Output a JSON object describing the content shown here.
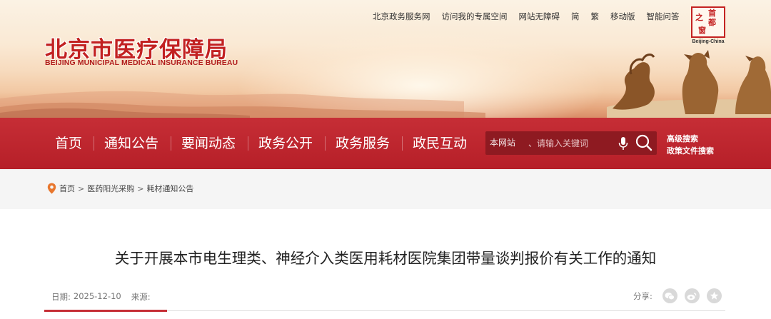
{
  "header": {
    "top_links": [
      "北京政务服务网",
      "访问我的专属空间",
      "网站无障碍",
      "简",
      "繁",
      "移动版",
      "智能问答"
    ],
    "logo_cn": "北京市医疗保障局",
    "logo_en": "BEIJING MUNICIPAL MEDICAL INSURANCE BUREAU",
    "seal": {
      "chars": [
        "首",
        "都",
        "之",
        "窗"
      ],
      "caption": "Beijing-China"
    }
  },
  "nav": {
    "items": [
      "首页",
      "通知公告",
      "要闻动态",
      "政务公开",
      "政务服务",
      "政民互动"
    ],
    "search_scope": "本网站",
    "search_placeholder": "、请输入关键词",
    "advanced_search": "高级搜索",
    "policy_search": "政策文件搜索"
  },
  "breadcrumb": [
    "首页",
    "医药阳光采购",
    "耗材通知公告"
  ],
  "article": {
    "title": "关于开展本市电生理类、神经介入类医用耗材医院集团带量谈判报价有关工作的通知",
    "date_label": "日期:",
    "date": "2025-12-10",
    "source_label": "来源:",
    "source": "",
    "share_label": "分享:"
  },
  "colors": {
    "brand_red": "#c62e36",
    "logo_red": "#c22121",
    "search_bg": "#8e1a21"
  },
  "icons": [
    "location-pin-icon",
    "microphone-icon",
    "search-icon",
    "wechat-icon",
    "weibo-icon",
    "favorite-icon"
  ]
}
